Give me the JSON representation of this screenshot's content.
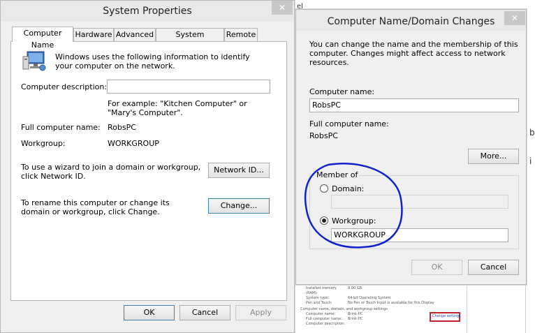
{
  "background": {
    "fragment_top": "el",
    "fragment_right": "b",
    "fragment_right2": "i",
    "list": [
      {
        "label": "Installed memory (RAM):",
        "value": "8.00 GB"
      },
      {
        "label": "System type:",
        "value": "64-bit Operating System"
      },
      {
        "label": "Pen and Touch:",
        "value": "No Pen or Touch Input is available for this Display"
      }
    ],
    "section": "Computer name, domain, and workgroup settings",
    "rows": [
      {
        "label": "Computer name:",
        "value": "Brink-PC"
      },
      {
        "label": "Full computer name:",
        "value": "Brink-PC"
      },
      {
        "label": "Computer description:",
        "value": ""
      }
    ],
    "change_settings": "Change settings"
  },
  "sysprops": {
    "title": "System Properties",
    "close": "✕",
    "tabs": [
      "Computer Name",
      "Hardware",
      "Advanced",
      "System Protection",
      "Remote"
    ],
    "intro": "Windows uses the following information to identify your computer on the network.",
    "desc_label": "Computer description:",
    "desc_value": "",
    "example": "For example: \"Kitchen Computer\" or \"Mary's Computer\".",
    "full_name_label": "Full computer name:",
    "full_name_value": "RobsPC",
    "workgroup_label": "Workgroup:",
    "workgroup_value": "WORKGROUP",
    "wizard_text": "To use a wizard to join a domain or workgroup, click Network ID.",
    "network_id_btn": "Network ID...",
    "rename_text": "To rename this computer or change its domain or workgroup, click Change.",
    "change_btn": "Change...",
    "ok": "OK",
    "cancel": "Cancel",
    "apply": "Apply"
  },
  "namechange": {
    "title": "Computer Name/Domain Changes",
    "close": "✕",
    "intro": "You can change the name and the membership of this computer. Changes might affect access to network resources.",
    "name_label": "Computer name:",
    "name_value": "RobsPC",
    "full_label": "Full computer name:",
    "full_value": "RobsPC",
    "more_btn": "More...",
    "member_of": "Member of",
    "domain_label": "Domain:",
    "domain_value": "",
    "workgroup_label": "Workgroup:",
    "workgroup_value": "WORKGROUP",
    "ok": "OK",
    "cancel": "Cancel"
  },
  "colors": {
    "annotation": "#1122cc",
    "highlight_box": "#c0262d"
  }
}
